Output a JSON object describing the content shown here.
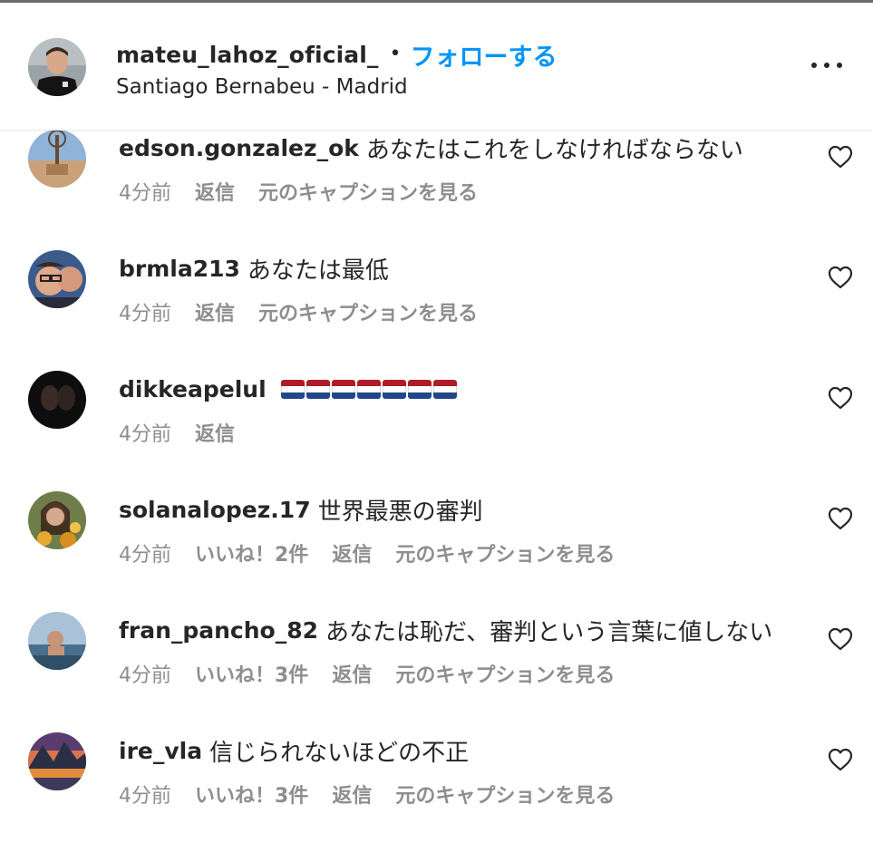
{
  "colors": {
    "accent": "#0095f6",
    "text": "#262626",
    "muted": "#8e8e8e"
  },
  "header": {
    "username": "mateu_lahoz_oficial_",
    "separator": "•",
    "follow_label": "フォローする",
    "location": "Santiago Bernabeu - Madrid",
    "more_icon": "more-horizontal-icon"
  },
  "comments": [
    {
      "user": "edson.gonzalez_ok",
      "text": "あなたはこれをしなければならない",
      "time": "4分前",
      "likes": "",
      "reply": "返信",
      "caption": "元のキャプションを見る"
    },
    {
      "user": "brmla213",
      "text": "あなたは最低",
      "time": "4分前",
      "likes": "",
      "reply": "返信",
      "caption": "元のキャプションを見る"
    },
    {
      "user": "dikkeapelul",
      "text": "",
      "emoji": "🇳🇱🇳🇱🇳🇱🇳🇱🇳🇱🇳🇱🇳🇱",
      "time": "4分前",
      "likes": "",
      "reply": "返信",
      "caption": ""
    },
    {
      "user": "solanalopez.17",
      "text": "世界最悪の審判",
      "time": "4分前",
      "likes": "いいね！2件",
      "reply": "返信",
      "caption": "元のキャプションを見る"
    },
    {
      "user": "fran_pancho_82",
      "text": "あなたは恥だ、審判という言葉に値しない",
      "time": "4分前",
      "likes": "いいね！3件",
      "reply": "返信",
      "caption": "元のキャプションを見る"
    },
    {
      "user": "ire_vla",
      "text": "信じられないほどの不正",
      "time": "4分前",
      "likes": "いいね！3件",
      "reply": "返信",
      "caption": "元のキャプションを見る"
    }
  ]
}
